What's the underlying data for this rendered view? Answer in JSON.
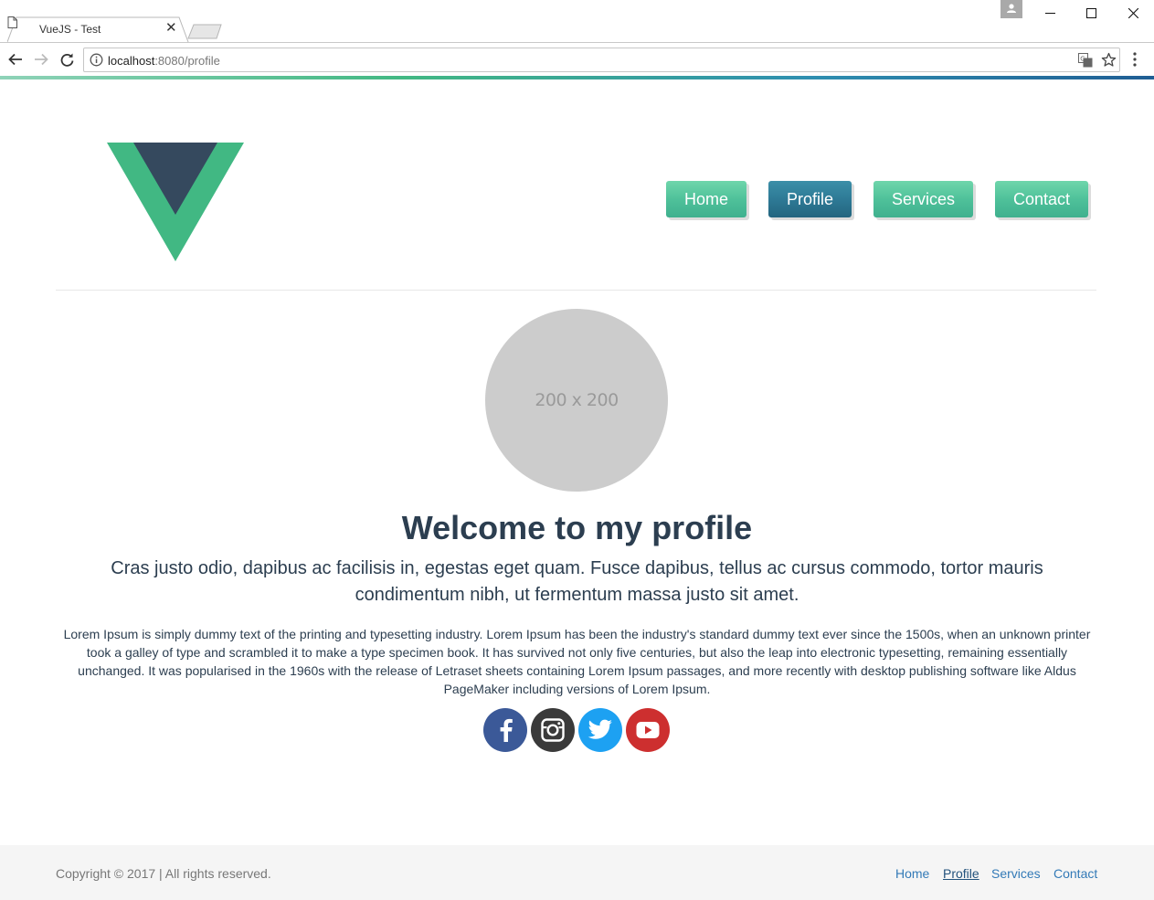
{
  "browser": {
    "tab_title": "VueJS - Test",
    "url_host": "localhost",
    "url_path": ":8080/profile"
  },
  "nav": {
    "items": [
      {
        "label": "Home",
        "active": false
      },
      {
        "label": "Profile",
        "active": true
      },
      {
        "label": "Services",
        "active": false
      },
      {
        "label": "Contact",
        "active": false
      }
    ]
  },
  "profile": {
    "avatar_placeholder": "200 x 200",
    "title": "Welcome to my profile",
    "lead": "Cras justo odio, dapibus ac facilisis in, egestas eget quam. Fusce dapibus, tellus ac cursus commodo, tortor mauris condimentum nibh, ut fermentum massa justo sit amet.",
    "body": "Lorem Ipsum is simply dummy text of the printing and typesetting industry. Lorem Ipsum has been the industry's standard dummy text ever since the 1500s, when an unknown printer took a galley of type and scrambled it to make a type specimen book. It has survived not only five centuries, but also the leap into electronic typesetting, remaining essentially unchanged. It was popularised in the 1960s with the release of Letraset sheets containing Lorem Ipsum passages, and more recently with desktop publishing software like Aldus PageMaker including versions of Lorem Ipsum."
  },
  "social": [
    {
      "icon": "facebook-icon",
      "color": "#3b5998"
    },
    {
      "icon": "instagram-icon",
      "color": "#3a3a3a"
    },
    {
      "icon": "twitter-icon",
      "color": "#1da1f2"
    },
    {
      "icon": "youtube-icon",
      "color": "#cd2f2f"
    }
  ],
  "footer": {
    "copyright": "Copyright © 2017 | All rights reserved.",
    "links": [
      "Home",
      "Profile",
      "Services",
      "Contact"
    ]
  },
  "colors": {
    "vue_green": "#41b883",
    "vue_dark": "#35495e",
    "nav_green": "#4fc19a",
    "nav_active": "#2e7a96",
    "text": "#2c3e50"
  }
}
